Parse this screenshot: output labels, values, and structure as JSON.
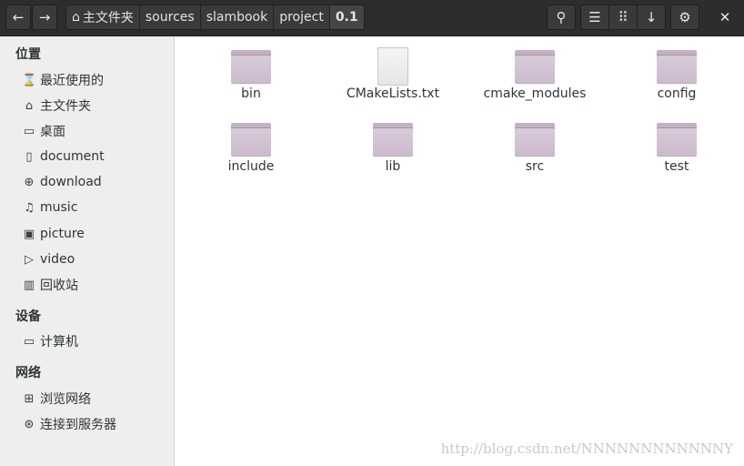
{
  "header": {
    "back_icon": "←",
    "forward_icon": "→",
    "breadcrumbs": [
      "主文件夹",
      "sources",
      "slambook",
      "project",
      "0.1"
    ],
    "search_icon": "⚲",
    "list_view_icon": "☰",
    "grid_view_icon": "⠿",
    "sort_icon": "↓",
    "settings_icon": "⚙",
    "close_icon": "✕"
  },
  "sidebar": {
    "places_title": "位置",
    "places": [
      {
        "icon": "⌛",
        "label": "最近使用的"
      },
      {
        "icon": "⌂",
        "label": "主文件夹"
      },
      {
        "icon": "▭",
        "label": "桌面"
      },
      {
        "icon": "▯",
        "label": "document"
      },
      {
        "icon": "⊕",
        "label": "download"
      },
      {
        "icon": "♫",
        "label": "music"
      },
      {
        "icon": "▣",
        "label": "picture"
      },
      {
        "icon": "▷",
        "label": "video"
      },
      {
        "icon": "▥",
        "label": "回收站"
      }
    ],
    "devices_title": "设备",
    "devices": [
      {
        "icon": "▭",
        "label": "计算机"
      }
    ],
    "network_title": "网络",
    "network": [
      {
        "icon": "⊞",
        "label": "浏览网络"
      },
      {
        "icon": "⊛",
        "label": "连接到服务器"
      }
    ]
  },
  "files": [
    {
      "name": "bin",
      "type": "folder"
    },
    {
      "name": "CMakeLists.txt",
      "type": "file"
    },
    {
      "name": "cmake_modules",
      "type": "folder"
    },
    {
      "name": "config",
      "type": "folder"
    },
    {
      "name": "include",
      "type": "folder"
    },
    {
      "name": "lib",
      "type": "folder"
    },
    {
      "name": "src",
      "type": "folder"
    },
    {
      "name": "test",
      "type": "folder"
    }
  ],
  "watermark": "http://blog.csdn.net/NNNNNNNNNNNNY"
}
